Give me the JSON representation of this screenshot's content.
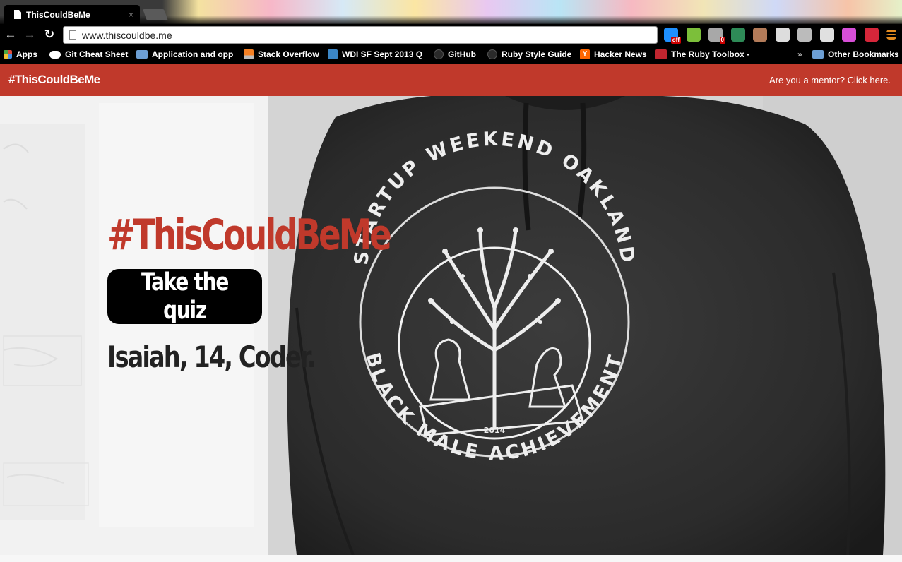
{
  "browser": {
    "tab": {
      "title": "ThisCouldBeMe",
      "close_glyph": "×"
    },
    "nav": {
      "back_glyph": "←",
      "forward_glyph": "→",
      "reload_glyph": "↻"
    },
    "url": "www.thiscouldbe.me",
    "extensions": [
      {
        "icon": "crosshair-extension-icon",
        "color": "#1e90ff",
        "badge": "off"
      },
      {
        "icon": "green-circle-extension-icon",
        "color": "#7cbf3a",
        "badge": ""
      },
      {
        "icon": "ghostery-extension-icon",
        "color": "#a8a8a8",
        "badge": "0"
      },
      {
        "icon": "green-arrow-extension-icon",
        "color": "#2e8b57",
        "badge": ""
      },
      {
        "icon": "instagram-extension-icon",
        "color": "#b47c5a",
        "badge": ""
      },
      {
        "icon": "eyedropper-extension-icon",
        "color": "#dddddd",
        "badge": ""
      },
      {
        "icon": "cast-extension-icon",
        "color": "#bbbbbb",
        "badge": ""
      },
      {
        "icon": "pocket-extension-icon",
        "color": "#e0e0e0",
        "badge": ""
      },
      {
        "icon": "frame-extension-icon",
        "color": "#d84fd8",
        "badge": ""
      },
      {
        "icon": "lastpass-extension-icon",
        "color": "#d6263a",
        "badge": ""
      },
      {
        "icon": "menu-icon",
        "color": "#e58c1f",
        "badge": ""
      }
    ],
    "bookmarks": [
      {
        "label": "Apps",
        "icon": "apps-grid-icon",
        "color": "#e04b3a"
      },
      {
        "label": "Git Cheat Sheet",
        "icon": "cloud-icon",
        "color": "#ffffff"
      },
      {
        "label": "Application and opp",
        "icon": "folder-icon",
        "color": "#6d9fd4"
      },
      {
        "label": "Stack Overflow",
        "icon": "stackoverflow-icon",
        "color": "#f48024"
      },
      {
        "label": "WDI SF Sept 2013 Q",
        "icon": "trello-icon",
        "color": "#3b86c6"
      },
      {
        "label": "GitHub",
        "icon": "github-icon",
        "color": "#333333"
      },
      {
        "label": "Ruby Style Guide",
        "icon": "github-icon",
        "color": "#333333"
      },
      {
        "label": "Hacker News",
        "icon": "hackernews-icon",
        "color": "#ff6600"
      },
      {
        "label": "The Ruby Toolbox -",
        "icon": "toolbox-icon",
        "color": "#c0252f"
      }
    ],
    "overflow_glyph": "»",
    "other_bookmarks": "Other Bookmarks"
  },
  "site": {
    "brand": "#ThisCouldBeMe",
    "mentor_link": "Are you a mentor? Click here.",
    "accent_color": "#c0392b"
  },
  "hero": {
    "headline": "#ThisCouldBeMe",
    "cta": "Take the quiz",
    "caption": "Isaiah, 14, Coder.",
    "shirt": {
      "top_text": "STARTUP WEEKEND OAKLAND",
      "bottom_text": "BLACK MALE ACHIEVEMENT",
      "year": "2014"
    }
  }
}
